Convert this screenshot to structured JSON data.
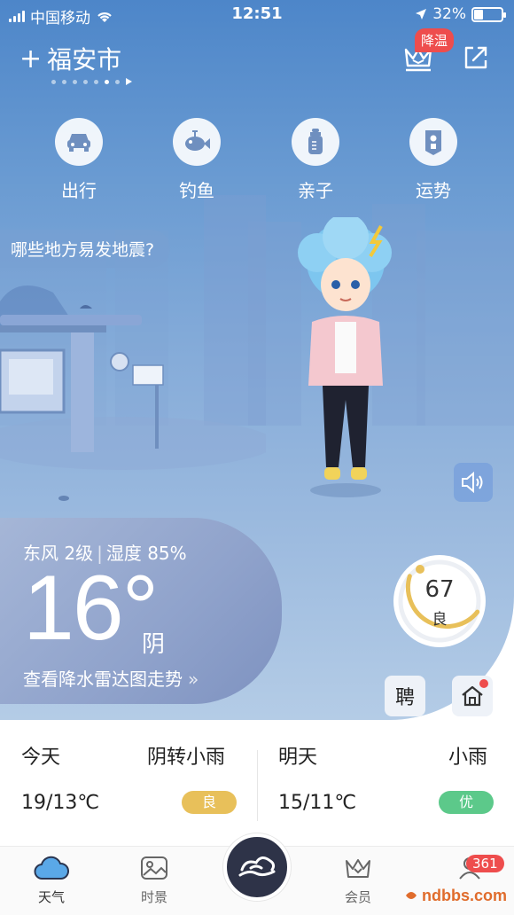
{
  "status_bar": {
    "carrier": "中国移动",
    "time": "12:51",
    "battery": "32%"
  },
  "header": {
    "city": "福安市",
    "add_symbol": "+",
    "badge": "降温"
  },
  "categories": [
    {
      "label": "出行",
      "icon": "car-icon"
    },
    {
      "label": "钓鱼",
      "icon": "fish-icon"
    },
    {
      "label": "亲子",
      "icon": "bottle-icon"
    },
    {
      "label": "运势",
      "icon": "fortune-icon"
    }
  ],
  "question": "哪些地方易发地震?",
  "current": {
    "wind": "东风 2级",
    "humidity": "湿度 85%",
    "temperature": "16°",
    "condition": "阴",
    "radar_link": "查看降水雷达图走势",
    "radar_arrows": "»"
  },
  "aqi": {
    "value": "67",
    "level": "良"
  },
  "side_buttons": {
    "hire": "聘"
  },
  "forecast": {
    "today": {
      "day": "今天",
      "weather": "阴转小雨",
      "temp": "19/13℃",
      "air": "良",
      "air_color": "#e8c05a"
    },
    "tomorrow": {
      "day": "明天",
      "weather": "小雨",
      "temp": "15/11℃",
      "air": "优",
      "air_color": "#5cc98a"
    }
  },
  "nav": {
    "weather": "天气",
    "scenery": "时景",
    "member": "会员",
    "message_badge": "361"
  },
  "watermark": "ndbbs.com",
  "colors": {
    "badge_red": "#ee4d4d",
    "nav_center": "#2e3348",
    "aqi_arc": "#e8c05a"
  }
}
